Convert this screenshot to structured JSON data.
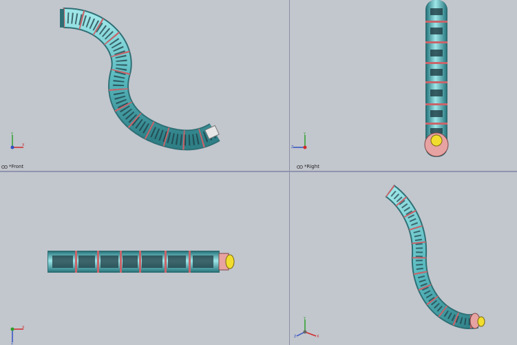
{
  "viewports": [
    {
      "id": "front",
      "label": "*Front",
      "axes": [
        "Y",
        "X"
      ]
    },
    {
      "id": "right",
      "label": "*Right",
      "axes": [
        "Y",
        "Z"
      ]
    },
    {
      "id": "top",
      "label": "",
      "axes": [
        "Z",
        "X"
      ]
    },
    {
      "id": "iso",
      "label": "",
      "axes": [
        "Y",
        "Z",
        "X"
      ]
    }
  ],
  "colors": {
    "background": "#c2c6cd",
    "segment": "#6fc6c9",
    "segment_dark": "#2f7f86",
    "ring": "#c9646a",
    "slot": "#1f3c44",
    "tip_pink": "#e7a2a2",
    "tip_yellow": "#f1dd2d"
  },
  "icons": {
    "view_toggle": "glasses-icon",
    "triad": "axis-triad-icon"
  }
}
